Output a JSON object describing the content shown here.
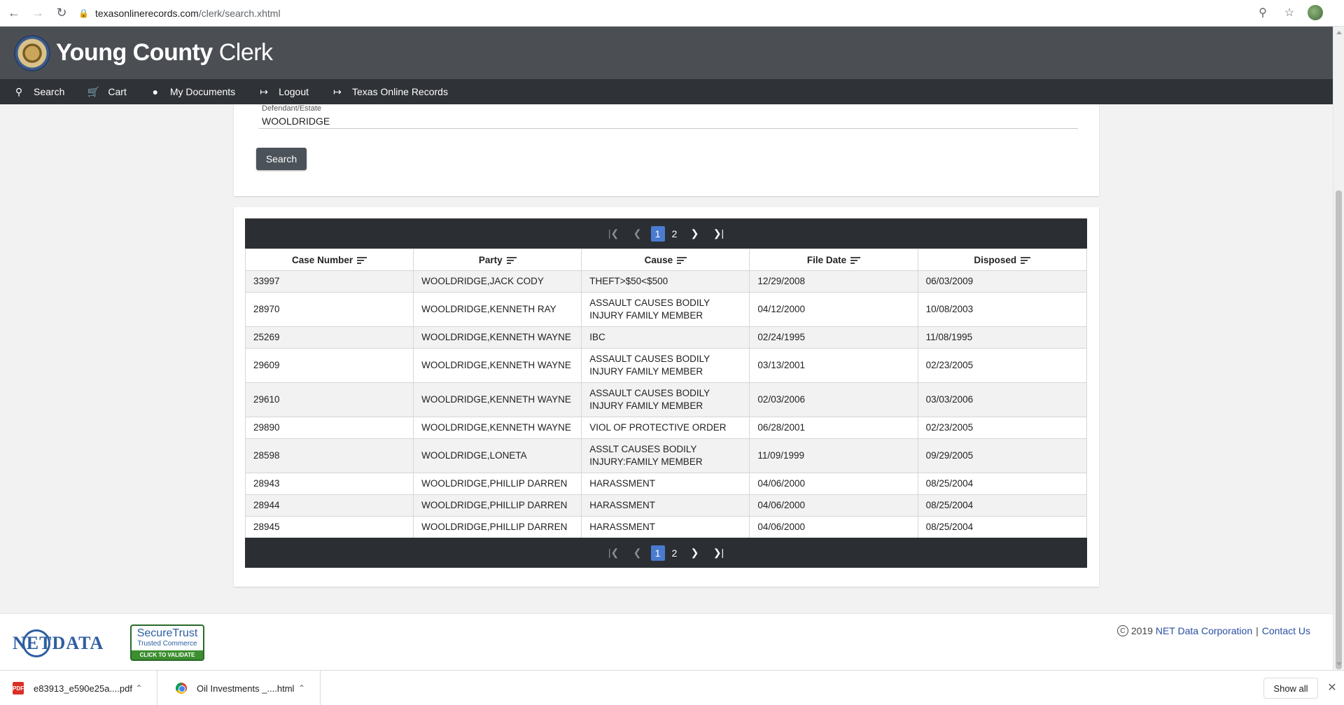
{
  "browser": {
    "url_host": "texasonlinerecords.com",
    "url_path": "/clerk/search.xhtml"
  },
  "header": {
    "title_bold": "Young County",
    "title_light": "Clerk"
  },
  "nav": {
    "items": [
      {
        "label": "Search",
        "icon": "search-icon"
      },
      {
        "label": "Cart",
        "icon": "cart-icon"
      },
      {
        "label": "My Documents",
        "icon": "account-circle-icon"
      },
      {
        "label": "Logout",
        "icon": "exit-icon"
      },
      {
        "label": "Texas Online Records",
        "icon": "exit-icon"
      }
    ]
  },
  "search_form": {
    "field_label": "Defendant/Estate",
    "field_value": "WOOLDRIDGE",
    "button_label": "Search"
  },
  "pagination": {
    "pages": [
      "1",
      "2"
    ],
    "current_page": "1"
  },
  "results": {
    "columns": [
      "Case Number",
      "Party",
      "Cause",
      "File Date",
      "Disposed"
    ],
    "rows": [
      {
        "case_number": "33997",
        "party": "WOOLDRIDGE,JACK CODY",
        "cause": "THEFT>$50<$500",
        "file_date": "12/29/2008",
        "disposed": "06/03/2009"
      },
      {
        "case_number": "28970",
        "party": "WOOLDRIDGE,KENNETH RAY",
        "cause": "ASSAULT CAUSES BODILY INJURY FAMILY MEMBER",
        "file_date": "04/12/2000",
        "disposed": "10/08/2003"
      },
      {
        "case_number": "25269",
        "party": "WOOLDRIDGE,KENNETH WAYNE",
        "cause": "IBC",
        "file_date": "02/24/1995",
        "disposed": "11/08/1995"
      },
      {
        "case_number": "29609",
        "party": "WOOLDRIDGE,KENNETH WAYNE",
        "cause": "ASSAULT CAUSES BODILY INJURY FAMILY MEMBER",
        "file_date": "03/13/2001",
        "disposed": "02/23/2005"
      },
      {
        "case_number": "29610",
        "party": "WOOLDRIDGE,KENNETH WAYNE",
        "cause": "ASSAULT CAUSES BODILY INJURY FAMILY MEMBER",
        "file_date": "02/03/2006",
        "disposed": "03/03/2006"
      },
      {
        "case_number": "29890",
        "party": "WOOLDRIDGE,KENNETH WAYNE",
        "cause": "VIOL OF PROTECTIVE ORDER",
        "file_date": "06/28/2001",
        "disposed": "02/23/2005"
      },
      {
        "case_number": "28598",
        "party": "WOOLDRIDGE,LONETA",
        "cause": "ASSLT CAUSES BODILY INJURY:FAMILY MEMBER",
        "file_date": "11/09/1999",
        "disposed": "09/29/2005"
      },
      {
        "case_number": "28943",
        "party": "WOOLDRIDGE,PHILLIP DARREN",
        "cause": "HARASSMENT",
        "file_date": "04/06/2000",
        "disposed": "08/25/2004"
      },
      {
        "case_number": "28944",
        "party": "WOOLDRIDGE,PHILLIP DARREN",
        "cause": "HARASSMENT",
        "file_date": "04/06/2000",
        "disposed": "08/25/2004"
      },
      {
        "case_number": "28945",
        "party": "WOOLDRIDGE,PHILLIP DARREN",
        "cause": "HARASSMENT",
        "file_date": "04/06/2000",
        "disposed": "08/25/2004"
      }
    ]
  },
  "footer": {
    "logo_text": "NETDATA",
    "badge_line1": "SecureTrust",
    "badge_line2": "Trusted Commerce",
    "badge_line3": "CLICK TO VALIDATE",
    "copyright_year": "2019",
    "company_link": "NET Data Corporation",
    "separator": "|",
    "contact_link": "Contact Us"
  },
  "downloads": {
    "items": [
      {
        "name": "e83913_e590e25a....pdf",
        "icon": "pdf-icon"
      },
      {
        "name": "Oil Investments _....html",
        "icon": "chrome-icon"
      }
    ],
    "show_all_label": "Show all"
  }
}
